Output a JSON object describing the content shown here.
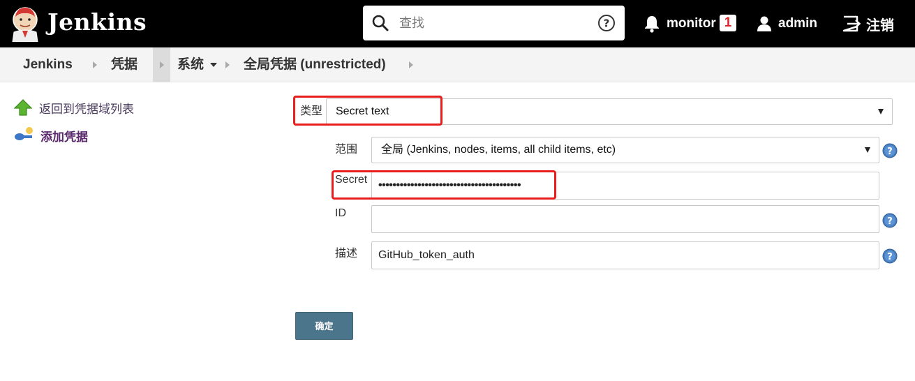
{
  "header": {
    "app_name": "Jenkins",
    "search_placeholder": "查找",
    "monitor_label": "monitor",
    "monitor_count": "1",
    "user_name": "admin",
    "logout_label": "注销"
  },
  "breadcrumb": {
    "items": [
      "Jenkins",
      "凭据",
      "系统",
      "全局凭据 (unrestricted)"
    ]
  },
  "sidebar": {
    "items": [
      {
        "label": "返回到凭据域列表",
        "icon": "up-arrow-icon"
      },
      {
        "label": "添加凭据",
        "icon": "key-icon"
      }
    ]
  },
  "form": {
    "kind_label": "类型",
    "kind_value": "Secret text",
    "scope_label": "范围",
    "scope_value": "全局 (Jenkins, nodes, items, all child items, etc)",
    "secret_label": "Secret",
    "secret_value": "••••••••••••••••••••••••••••••••••••••••",
    "id_label": "ID",
    "id_value": "",
    "description_label": "描述",
    "description_value": "GitHub_token_auth",
    "submit_label": "确定"
  },
  "colors": {
    "header_bg": "#000000",
    "highlight_box": "#e81e1e",
    "submit_bg": "#4b758b",
    "help_icon": "#4a7fbf"
  }
}
